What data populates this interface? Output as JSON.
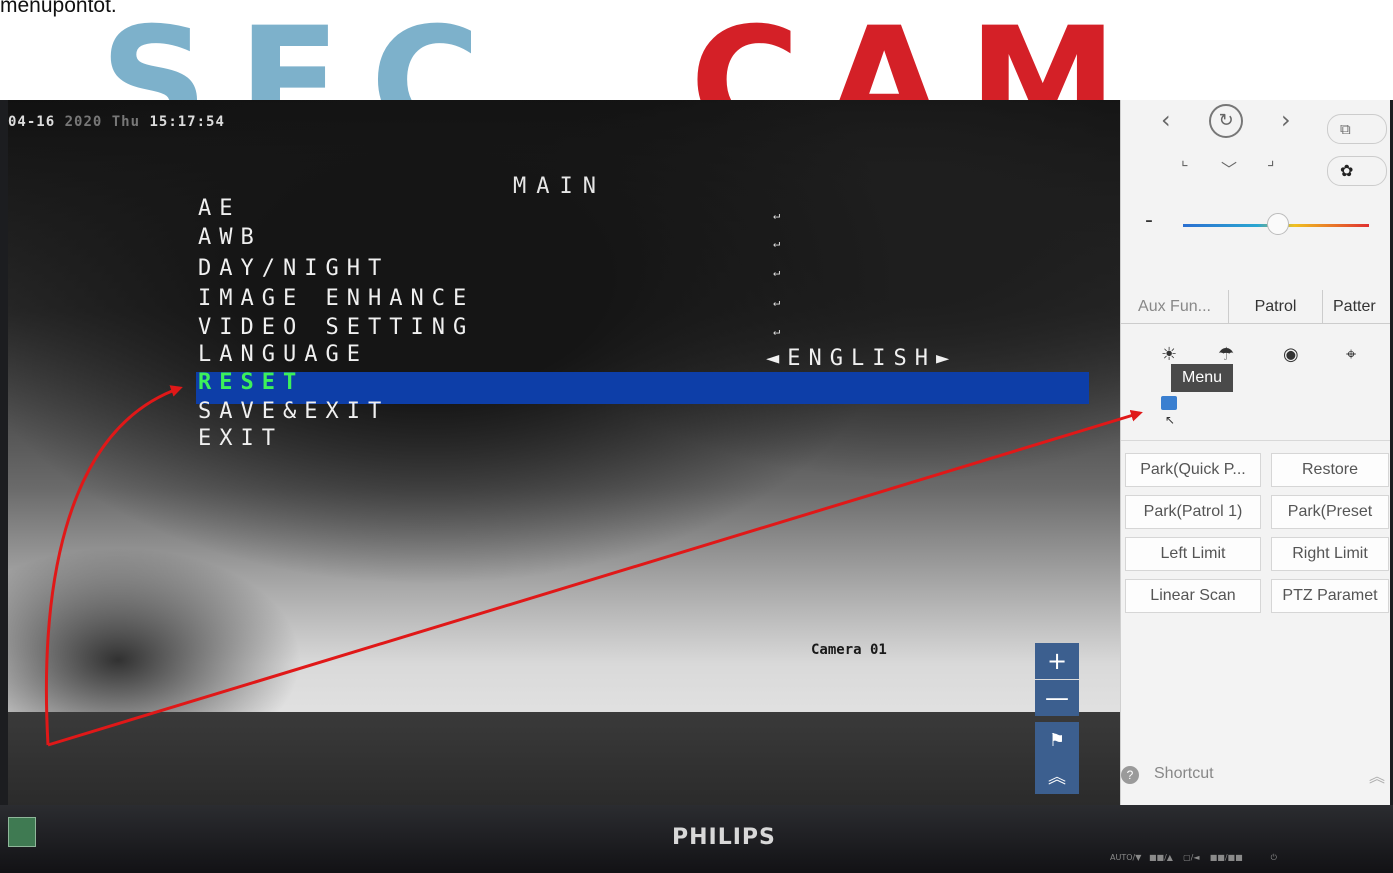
{
  "article": {
    "caption": "menupontot.",
    "watermark_left": "SEC",
    "watermark_right": "CAM"
  },
  "osd": {
    "date_prefix": "04-16",
    "date_dim": "2020 Thu",
    "time": "15:17:54",
    "title": "MAIN",
    "menu_items": [
      "AE",
      "AWB",
      "DAY/NIGHT",
      "IMAGE ENHANCE",
      "VIDEO SETTING",
      "LANGUAGE",
      "RESET",
      "SAVE&EXIT",
      "EXIT"
    ],
    "enter_mark": "↵",
    "language_value": "◄ENGLISH►",
    "selected_item": "RESET",
    "camera_label": "Camera 01"
  },
  "video_controls": {
    "zoom_in": "+",
    "zoom_out": "—",
    "flag": "⚑",
    "collapse": "︽"
  },
  "ptz": {
    "tabs": [
      "Aux Fun...",
      "Patrol",
      "Patter"
    ],
    "tooltip": "Menu",
    "slider_minus": "-",
    "buttons": [
      [
        "Park(Quick P...",
        "Restore"
      ],
      [
        "Park(Patrol 1)",
        "Park(Preset"
      ],
      [
        "Left Limit",
        "Right Limit"
      ],
      [
        "Linear Scan",
        "PTZ Paramet"
      ]
    ],
    "shortcut_label": "Shortcut",
    "shortcut_icon": "?",
    "shortcut_collapse": "︽"
  },
  "bezel": {
    "brand": "PHILIPS",
    "controls": "AUTO/▼   ■■/▲    ▢/◄    ■■/■■           ⏻"
  },
  "colors": {
    "highlight": "#0d3ea8",
    "selected_text": "#3df05a",
    "arrow": "#e01818",
    "zoom_button": "#3c5f8f"
  }
}
